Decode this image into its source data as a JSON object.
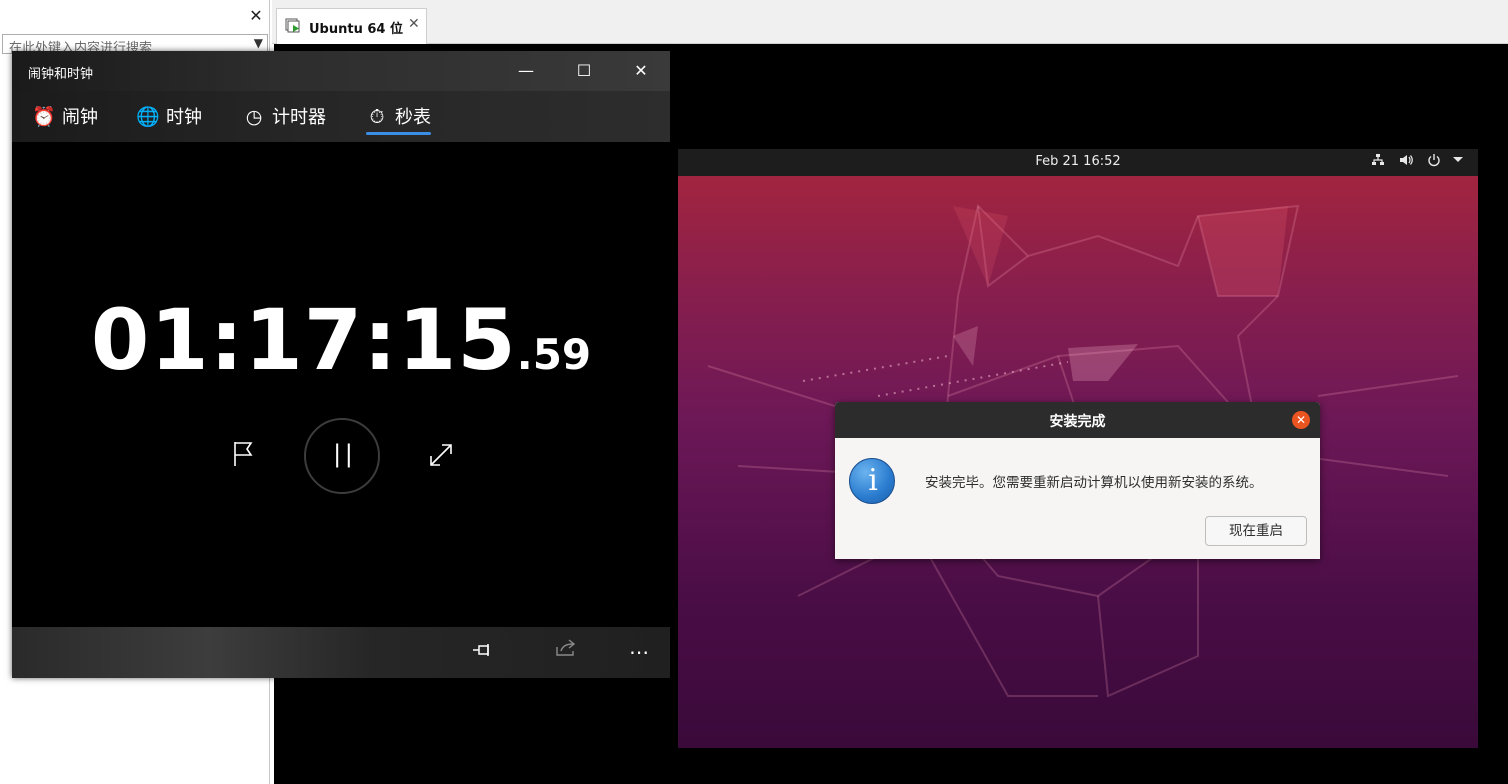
{
  "vmware": {
    "library_search_placeholder": "在此处键入内容进行搜索",
    "library_close": "✕",
    "dropdown": "▼",
    "tab": {
      "label": "Ubuntu 64 位",
      "close": "✕",
      "icon": "vm-icon"
    }
  },
  "clock_app": {
    "title": "闹钟和时钟",
    "caption": {
      "minimize": "—",
      "maximize": "☐",
      "close": "✕"
    },
    "tabs": [
      {
        "label": "闹钟",
        "icon": "alarm-icon"
      },
      {
        "label": "时钟",
        "icon": "world-clock-icon"
      },
      {
        "label": "计时器",
        "icon": "timer-icon"
      },
      {
        "label": "秒表",
        "icon": "stopwatch-icon",
        "active": true
      }
    ],
    "stopwatch": {
      "time": "01:17:15",
      "fraction": ".59"
    },
    "controls": {
      "lap": "flag-icon",
      "pause": "pause-icon",
      "expand": "expand-icon"
    },
    "bottom_bar": {
      "pin": "pin-icon",
      "share": "share-icon",
      "more": "⋯"
    },
    "accent_color": "#3a8ee6"
  },
  "ubuntu": {
    "topbar": {
      "datetime": "Feb 21  16:52",
      "tray_icons": [
        "network-icon",
        "volume-icon",
        "power-icon",
        "menu-arrow-icon"
      ]
    },
    "dialog": {
      "title": "安装完成",
      "message": "安装完毕。您需要重新启动计算机以使用新安装的系统。",
      "button": "现在重启",
      "icon": "info-icon",
      "close_color": "#e95420"
    }
  }
}
